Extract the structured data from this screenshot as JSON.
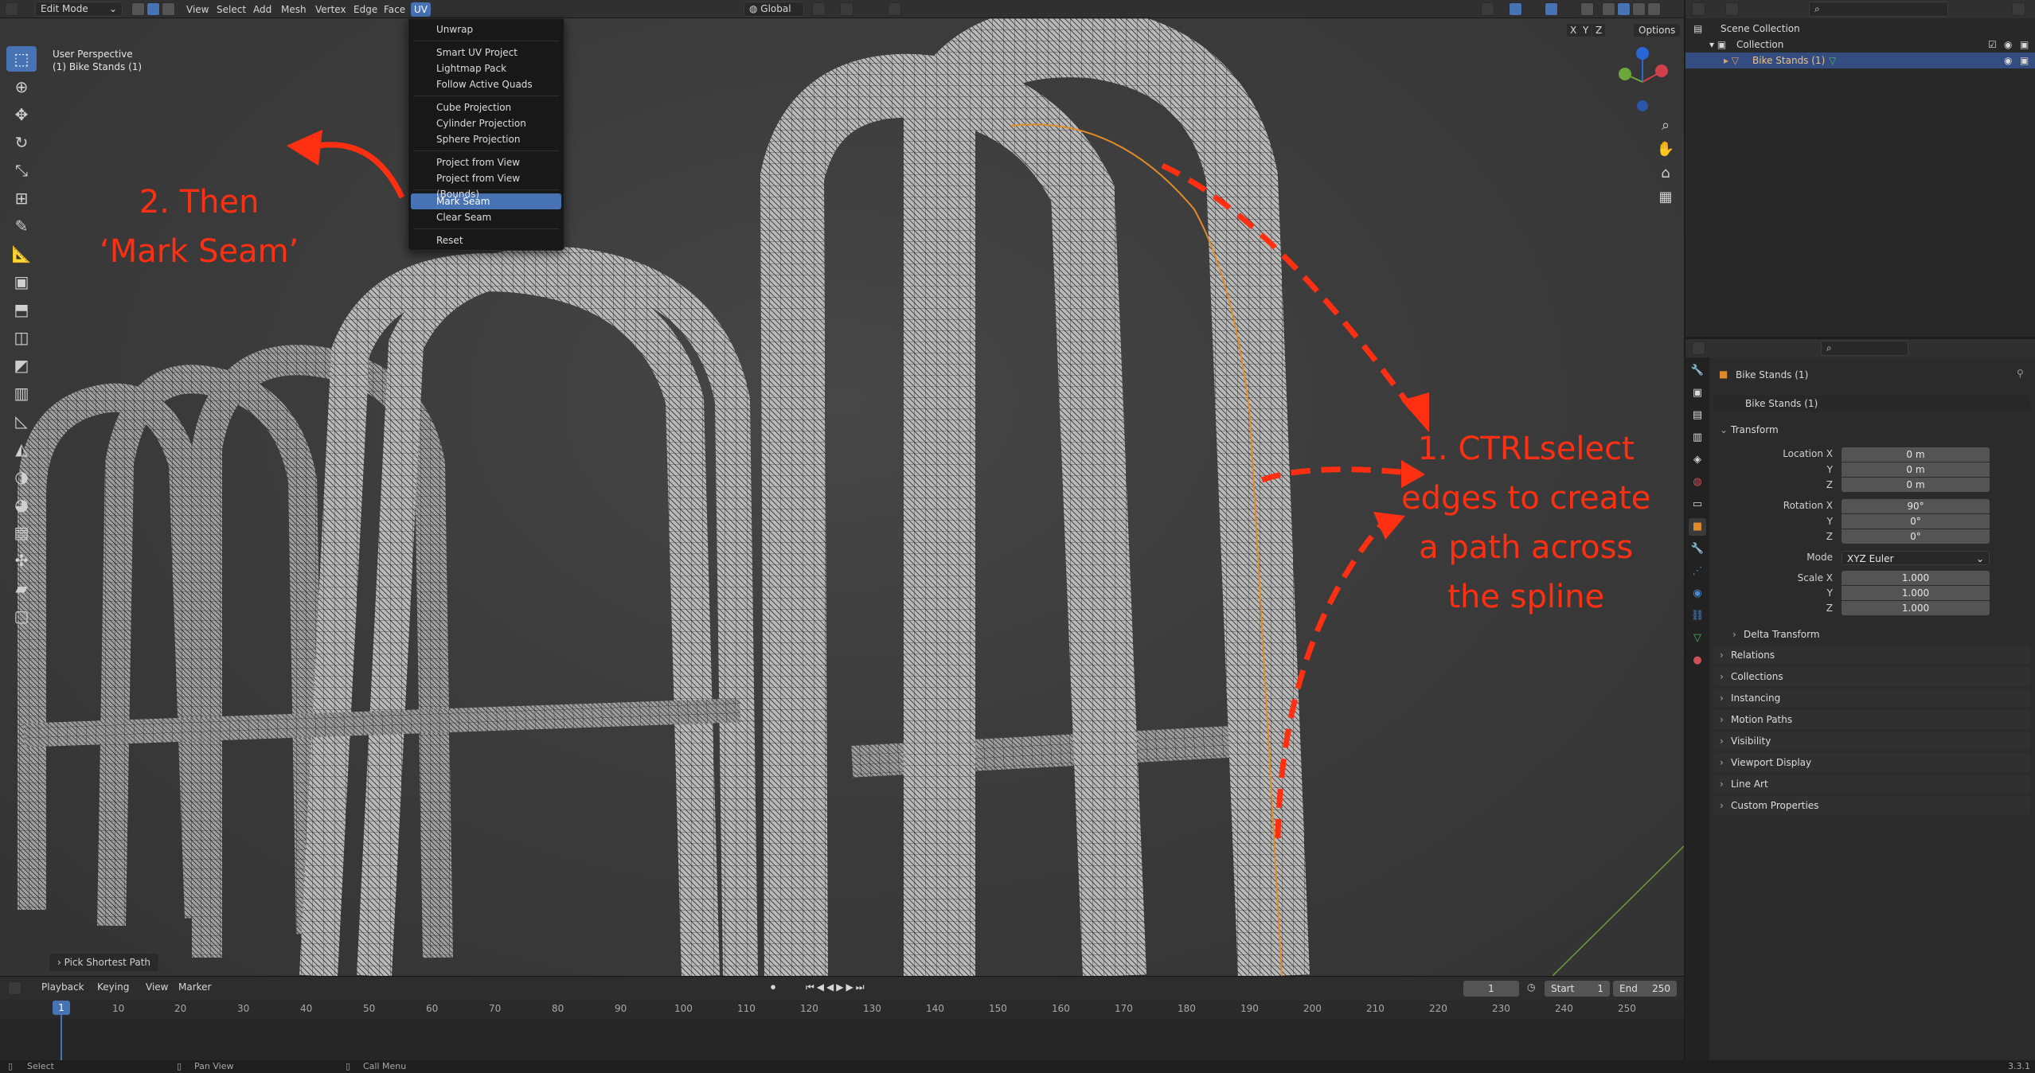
{
  "header": {
    "mode": "Edit Mode",
    "menus": [
      "View",
      "Select",
      "Add",
      "Mesh",
      "Vertex",
      "Edge",
      "Face",
      "UV"
    ],
    "transform_orientation": "Global",
    "options_label": "Options",
    "axis_labels": [
      "X",
      "Y",
      "Z"
    ]
  },
  "viewport": {
    "perspective": "User Perspective",
    "object_label": "(1) Bike Stands (1)",
    "last_operator": "Pick Shortest Path"
  },
  "uv_menu": {
    "items": [
      {
        "label": "Unwrap"
      },
      {
        "label": "Smart UV Project"
      },
      {
        "label": "Lightmap Pack"
      },
      {
        "label": "Follow Active Quads"
      },
      {
        "label": "Cube Projection"
      },
      {
        "label": "Cylinder Projection"
      },
      {
        "label": "Sphere Projection"
      },
      {
        "label": "Project from View"
      },
      {
        "label": "Project from View (Bounds)"
      },
      {
        "label": "Mark Seam"
      },
      {
        "label": "Clear Seam"
      },
      {
        "label": "Reset"
      }
    ]
  },
  "annotations": {
    "step2_line1": "2. Then",
    "step2_line2": "‘Mark Seam’",
    "step1_line1": "1. CTRLselect",
    "step1_line2": "edges to create",
    "step1_line3": "a  path  across",
    "step1_line4": "the spline"
  },
  "timeline": {
    "menus": [
      "Playback",
      "Keying",
      "View",
      "Marker"
    ],
    "current_frame": "1",
    "start_label": "Start",
    "start_value": "1",
    "end_label": "End",
    "end_value": "250",
    "ticks": [
      "10",
      "20",
      "30",
      "40",
      "50",
      "60",
      "70",
      "80",
      "90",
      "100",
      "110",
      "120",
      "130",
      "140",
      "150",
      "160",
      "170",
      "180",
      "190",
      "200",
      "210",
      "220",
      "230",
      "240",
      "250"
    ],
    "playhead": "1"
  },
  "status_bar": {
    "left": "Select",
    "middle": "Pan View",
    "right": "Call Menu",
    "version": "3.3.1"
  },
  "outliner": {
    "scene_collection": "Scene Collection",
    "collection": "Collection",
    "object": "Bike Stands (1)"
  },
  "properties": {
    "object_name": "Bike Stands (1)",
    "data_name": "Bike Stands (1)",
    "transform_header": "Transform",
    "location_x_label": "Location X",
    "y_label": "Y",
    "z_label": "Z",
    "location": [
      "0 m",
      "0 m",
      "0 m"
    ],
    "rotation_x_label": "Rotation X",
    "rotation": [
      "90°",
      "0°",
      "0°"
    ],
    "mode_label": "Mode",
    "mode_value": "XYZ Euler",
    "scale_x_label": "Scale X",
    "scale": [
      "1.000",
      "1.000",
      "1.000"
    ],
    "delta_transform": "Delta Transform",
    "panels": [
      "Relations",
      "Collections",
      "Instancing",
      "Motion Paths",
      "Visibility",
      "Viewport Display",
      "Line Art",
      "Custom Properties"
    ]
  },
  "colors": {
    "accent": "#4772b3",
    "annotation": "#ff2f12",
    "seam": "#e08a2a"
  }
}
